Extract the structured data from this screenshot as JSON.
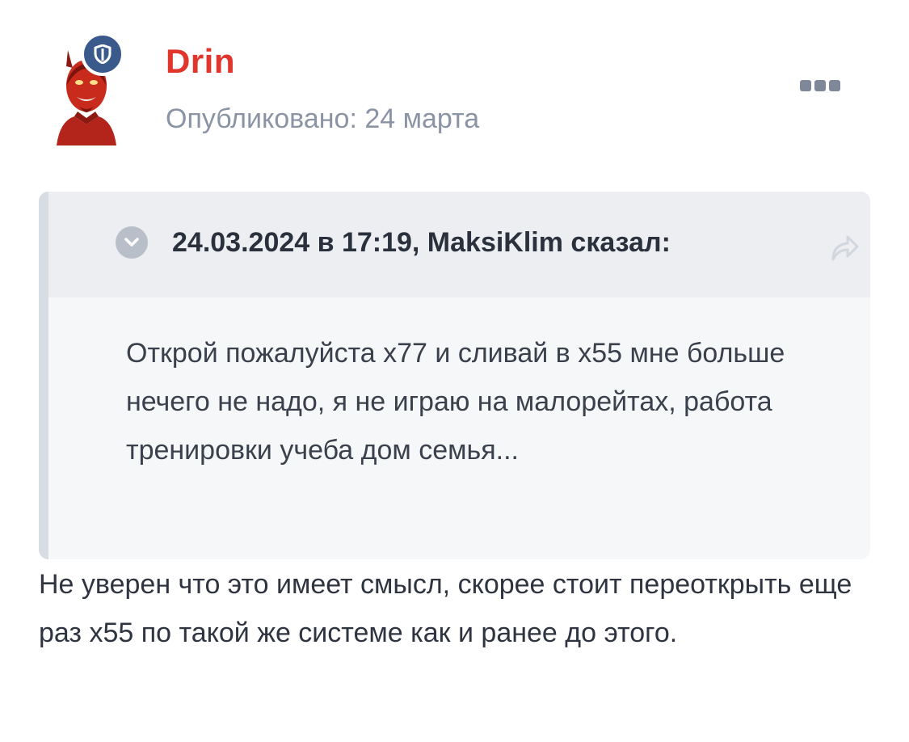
{
  "post": {
    "author": "Drin",
    "published": "Опубликовано: 24 марта",
    "badge_icon": "shield-icon",
    "menu_icon": "more-dots-icon"
  },
  "quote": {
    "title": "24.03.2024 в 17:19, MaksiKlim сказал:",
    "text": "Открой пожалуйста х77 и сливай в х55 мне больше нечего не надо, я не играю на малорейтах, работа тренировки учеба дом семья...",
    "expand_icon": "chevron-down-icon",
    "share_icon": "share-arrow-icon"
  },
  "reply": {
    "text": "Не уверен что это имеет смысл, скорее стоит переоткрыть еще раз х55 по такой же системе как и ранее до этого."
  },
  "colors": {
    "author_name": "#e0362b",
    "badge": "#3b5a8c",
    "meta_text": "#8a94a4"
  }
}
